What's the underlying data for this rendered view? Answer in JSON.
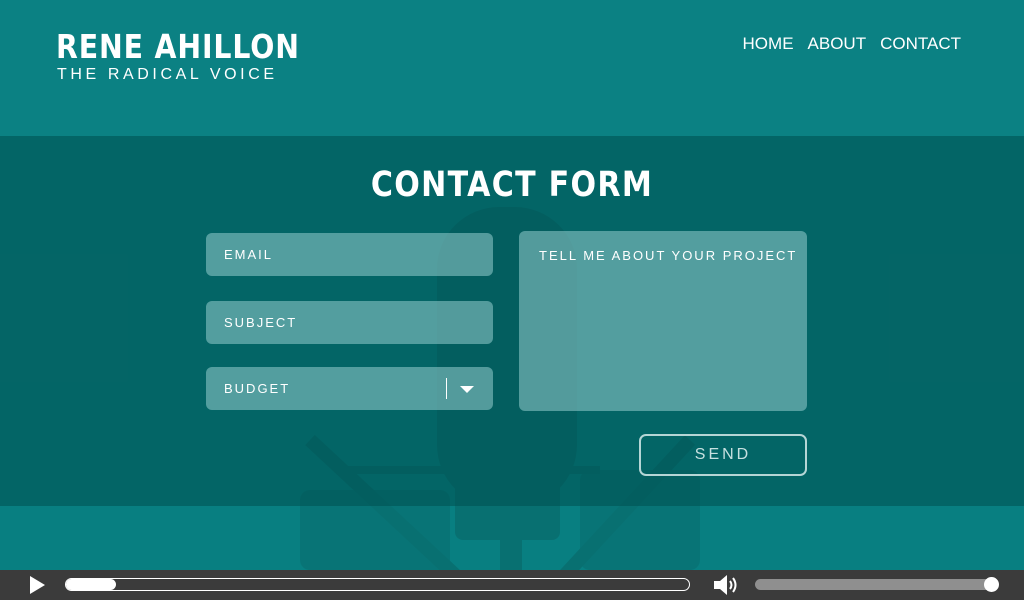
{
  "brand": {
    "name": "RENE AHILLON",
    "tagline": "THE RADICAL VOICE"
  },
  "nav": {
    "items": [
      "HOME",
      "ABOUT",
      "CONTACT"
    ]
  },
  "contact": {
    "title": "CONTACT FORM",
    "email_placeholder": "EMAIL",
    "subject_placeholder": "SUBJECT",
    "budget_label": "BUDGET",
    "message_placeholder": "TELL ME ABOUT YOUR PROJECT",
    "send_label": "SEND"
  },
  "player": {
    "progress_fraction": 0.08,
    "volume_fraction": 0.98,
    "icons": [
      "play-icon",
      "volume-icon"
    ]
  },
  "colors": {
    "brand_teal": "#0b8183",
    "form_band": "#005f5f",
    "player_bg": "#3b3b3b"
  }
}
